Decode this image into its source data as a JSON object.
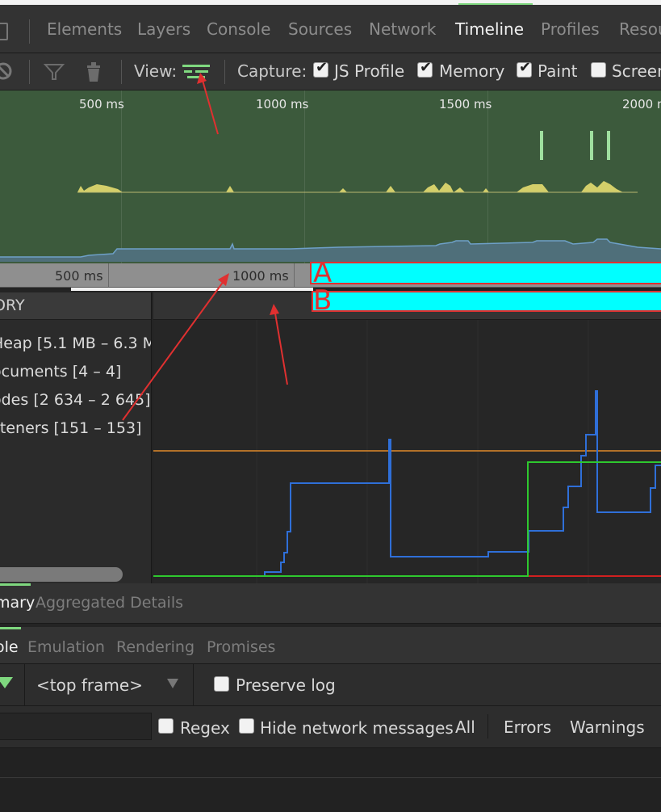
{
  "tabs": [
    "Elements",
    "Layers",
    "Console",
    "Sources",
    "Network",
    "Timeline",
    "Profiles",
    "Resou"
  ],
  "active_tab": "Timeline",
  "toolbar": {
    "view_label": "View:",
    "capture_label": "Capture:",
    "captures": [
      {
        "label": "JS Profile",
        "checked": true
      },
      {
        "label": "Memory",
        "checked": true
      },
      {
        "label": "Paint",
        "checked": true
      },
      {
        "label": "Screen",
        "checked": false
      }
    ]
  },
  "overview": {
    "ticks": [
      "500 ms",
      "1000 ms",
      "1500 ms",
      "2000 m"
    ]
  },
  "ruler": {
    "ticks": [
      "500 ms",
      "1000 ms"
    ]
  },
  "annotations": {
    "a": "A",
    "b": "B"
  },
  "memory_panel": {
    "header": "ORY",
    "counters": [
      " Heap [5.1 MB – 6.3 M",
      "ocuments [4 – 4]",
      "odes [2 634 – 2 645]",
      "steners [151 – 153]"
    ]
  },
  "detail_tabs": [
    "mary",
    "Aggregated Details"
  ],
  "drawer_tabs": [
    "ole",
    "Emulation",
    "Rendering",
    "Promises"
  ],
  "console_bar": {
    "frame": "<top frame>",
    "preserve_log": "Preserve log"
  },
  "filter_bar": {
    "regex": "Regex",
    "hide_network": "Hide network messages",
    "levels": [
      "All",
      "Errors",
      "Warnings"
    ]
  },
  "colors": {
    "accent": "#7fd87f",
    "overview_bg": "#3c5a3c",
    "heap_line": "#2f6fd8",
    "documents_line": "#e08a2a",
    "nodes_line": "#2ec82e",
    "listeners_line": "#d02020",
    "highlight": "#00ffff",
    "annotation": "#e03030"
  }
}
